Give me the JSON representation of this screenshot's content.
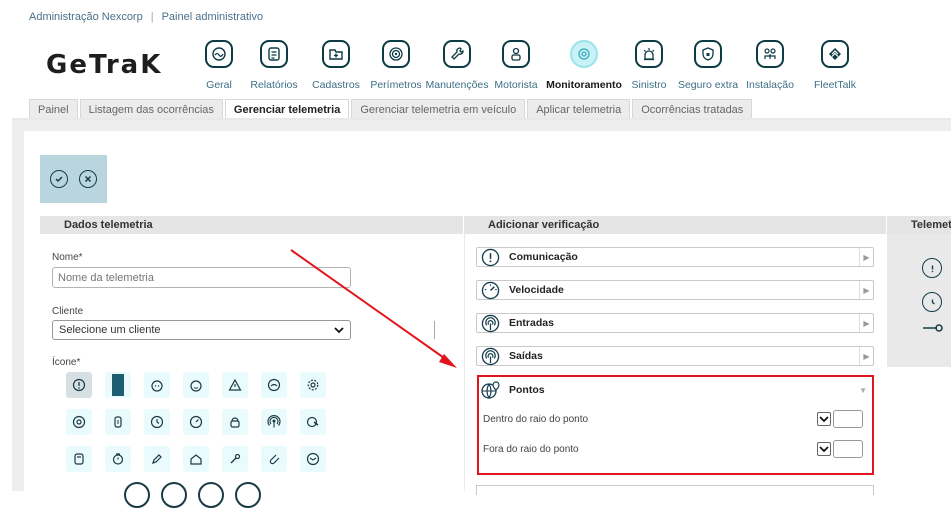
{
  "breadcrumb": {
    "org": "Administração Nexcorp",
    "section": "Painel administrativo"
  },
  "logo": "GeTraK",
  "nav": [
    {
      "label": "Geral",
      "icon": "gauge-icon"
    },
    {
      "label": "Relatórios",
      "icon": "report-icon"
    },
    {
      "label": "Cadastros",
      "icon": "folder-plus-icon"
    },
    {
      "label": "Perímetros",
      "icon": "target-icon"
    },
    {
      "label": "Manutenções",
      "icon": "wrench-icon"
    },
    {
      "label": "Motorista",
      "icon": "driver-icon"
    },
    {
      "label": "Monitoramento",
      "icon": "monitor-radar-icon",
      "active": true
    },
    {
      "label": "Sinistro",
      "icon": "alarm-icon"
    },
    {
      "label": "Seguro extra",
      "icon": "shield-lock-icon"
    },
    {
      "label": "Instalação",
      "icon": "install-icon"
    },
    {
      "label": "FleetTalk",
      "icon": "fleettalk-icon"
    }
  ],
  "tabs": [
    {
      "label": "Painel"
    },
    {
      "label": "Listagem das ocorrências"
    },
    {
      "label": "Gerenciar telemetria",
      "active": true
    },
    {
      "label": "Gerenciar telemetria em veículo"
    },
    {
      "label": "Aplicar telemetria"
    },
    {
      "label": "Ocorrências tratadas"
    }
  ],
  "sections": {
    "dados": "Dados telemetria",
    "adicionar": "Adicionar verificação",
    "telemetria": "Telemetria"
  },
  "form": {
    "nome_label": "Nome*",
    "nome_placeholder": "Nome da telemetria",
    "cliente_label": "Cliente",
    "cliente_value": "Selecione um cliente",
    "icone_label": "Ícone*"
  },
  "checks": [
    {
      "label": "Comunicação",
      "icon": "alert-circle-icon"
    },
    {
      "label": "Velocidade",
      "icon": "speedometer-icon"
    },
    {
      "label": "Entradas",
      "icon": "signal-in-icon"
    },
    {
      "label": "Saídas",
      "icon": "signal-out-icon"
    }
  ],
  "pontos": {
    "title": "Pontos",
    "icon": "globe-pin-icon",
    "rows": [
      "Dentro do raio do ponto",
      "Fora do raio do ponto"
    ]
  },
  "colors": {
    "accent": "#c9f2f7",
    "dark": "#0c3b44",
    "highlight": "#e2141c",
    "link": "#4a6f8a"
  }
}
